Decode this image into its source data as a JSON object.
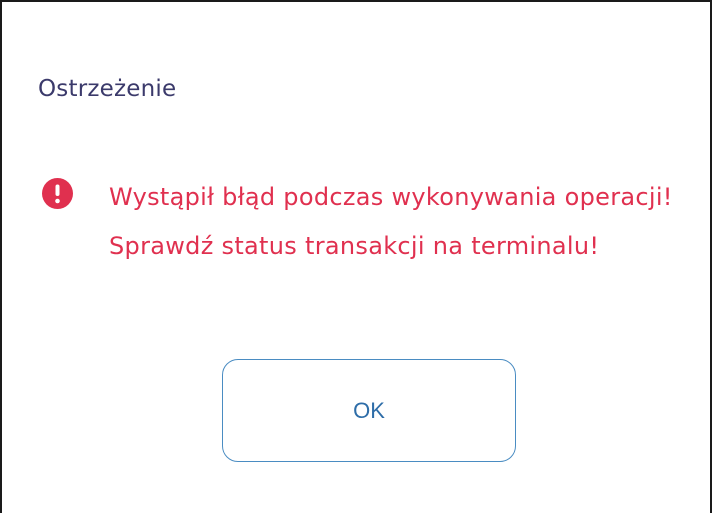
{
  "dialog": {
    "title": "Ostrzeżenie",
    "alert_icon": "exclamation-circle-icon",
    "message": "Wystąpił błąd podczas wykonywania operacji! Sprawdź status transakcji na terminalu!",
    "ok_label": "OK"
  },
  "colors": {
    "title": "#3b3a6b",
    "error": "#e0304f",
    "button_border": "#4a8cc2",
    "button_text": "#2e6da8"
  }
}
